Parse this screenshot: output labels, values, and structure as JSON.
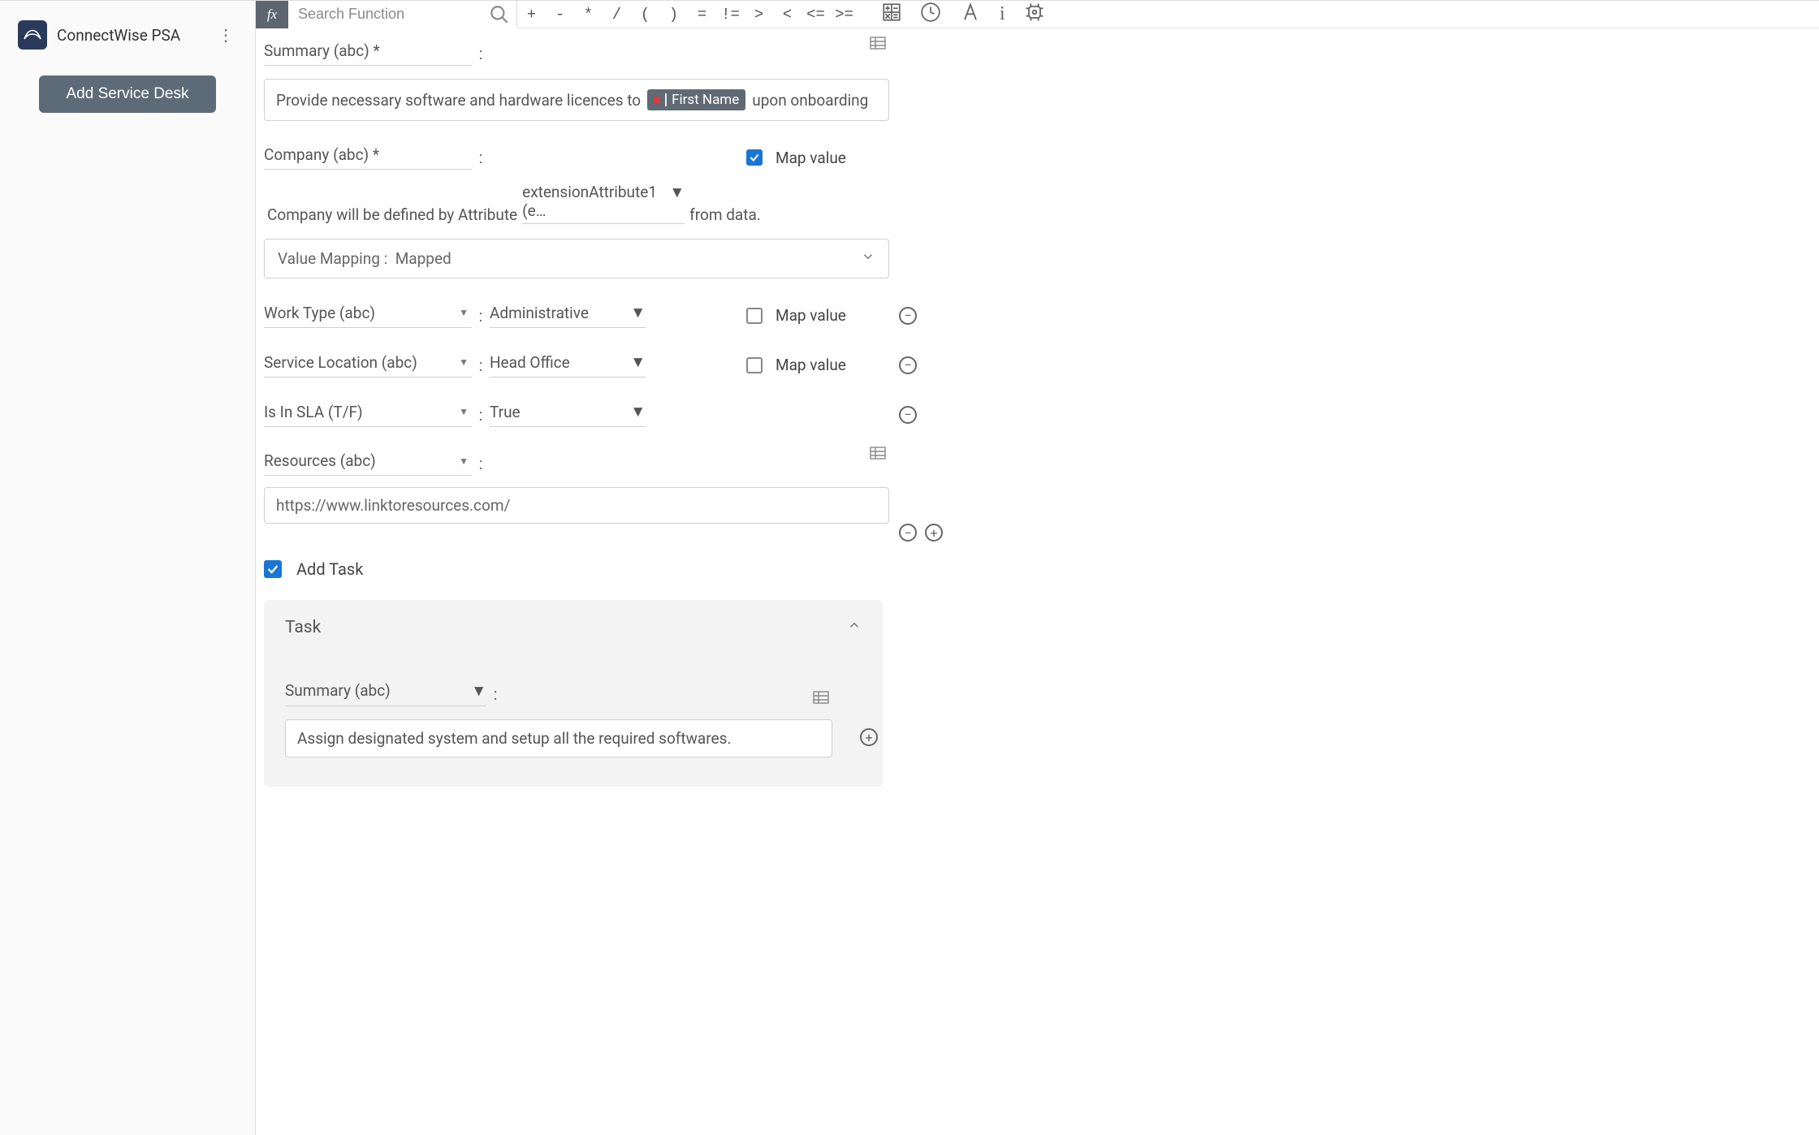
{
  "sidebar": {
    "appName": "ConnectWise PSA",
    "primaryButton": "Add Service Desk"
  },
  "toolbar": {
    "searchPlaceholder": "Search Function",
    "ops": [
      "+",
      "-",
      "*",
      "/",
      "(",
      ")",
      "=",
      "!=",
      ">",
      "<",
      "<=",
      ">="
    ]
  },
  "fields": {
    "summary": {
      "label": "Summary (abc) *",
      "templateBefore": "Provide necessary software and hardware licences to",
      "pill": "First Name",
      "templateAfter": "upon onboarding"
    },
    "company": {
      "label": "Company (abc) *",
      "mapValueChecked": true,
      "mapValueLabel": "Map value",
      "attrBefore": "Company will be defined by Attribute",
      "attrValue": "extensionAttribute1 (e…",
      "attrAfter": "from data.",
      "accordionLabel": "Value Mapping :",
      "accordionValue": "Mapped"
    },
    "workType": {
      "label": "Work Type (abc)",
      "value": "Administrative",
      "mapValueLabel": "Map value"
    },
    "serviceLocation": {
      "label": "Service Location (abc)",
      "value": "Head Office",
      "mapValueLabel": "Map value"
    },
    "isInSla": {
      "label": "Is In SLA (T/F)",
      "value": "True"
    },
    "resources": {
      "label": "Resources (abc)",
      "value": "https://www.linktoresources.com/"
    },
    "addTask": {
      "label": "Add Task"
    },
    "task": {
      "panelTitle": "Task",
      "summaryLabel": "Summary (abc)",
      "summaryValue": "Assign designated system and setup all the required softwares."
    }
  }
}
